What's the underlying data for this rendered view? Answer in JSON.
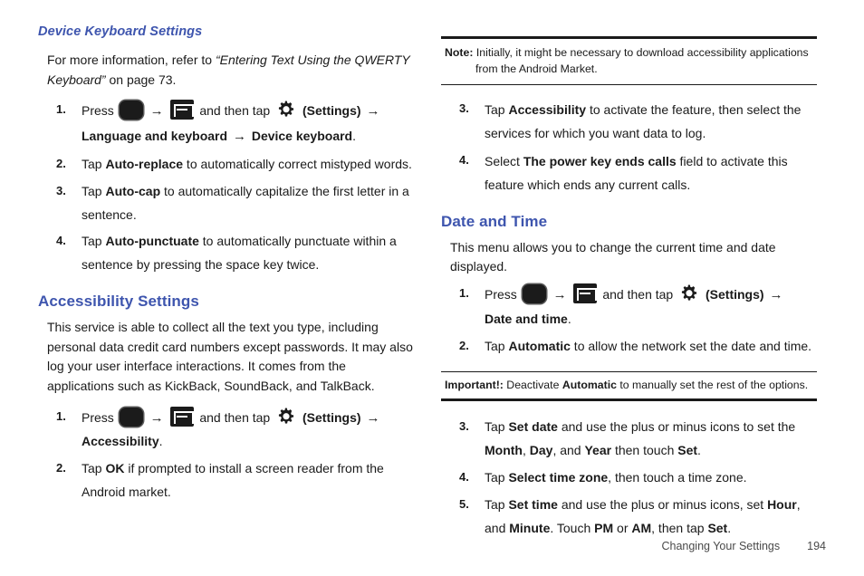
{
  "page": {
    "footer_section": "Changing Your Settings",
    "footer_page_number": "194",
    "heading_color": "#3e55ae",
    "text_color": "#1a1a1a"
  },
  "left_column": {
    "subsection_heading": "Device Keyboard Settings",
    "intro": {
      "lead": "For more information, refer to ",
      "ref_title": "“Entering Text Using the QWERTY Keyboard”",
      "tail": " on page 73."
    },
    "keyboard_steps": [
      {
        "num": "1.",
        "press_label": "Press",
        "and_then_tap": "and then tap",
        "settings_label": "(Settings)",
        "path_1": "Language and keyboard",
        "path_2": "Device keyboard",
        "period": "."
      },
      {
        "num": "2.",
        "lead": "Tap ",
        "bold": "Auto-replace",
        "tail": " to automatically correct mistyped words."
      },
      {
        "num": "3.",
        "lead": "Tap ",
        "bold": "Auto-cap",
        "tail": " to automatically capitalize the first letter in a sentence."
      },
      {
        "num": "4.",
        "lead": "Tap ",
        "bold": "Auto-punctuate",
        "tail": " to automatically punctuate within a sentence by pressing the space key twice."
      }
    ],
    "accessibility": {
      "heading": "Accessibility Settings",
      "paragraph": "This service is able to collect all the text you type, including personal data credit card numbers except passwords. It may also log your user interface interactions. It comes from the applications such as KickBack, SoundBack, and TalkBack.",
      "steps": [
        {
          "num": "1.",
          "press_label": "Press",
          "and_then_tap": "and then tap",
          "settings_label": "(Settings)",
          "path_1": "Accessibility",
          "period": "."
        },
        {
          "num": "2.",
          "lead": "Tap ",
          "bold": "OK",
          "tail": " if prompted to install a screen reader from the Android market."
        }
      ]
    }
  },
  "right_column": {
    "note": {
      "label": "Note:",
      "line1": " Initially, it might be necessary to download accessibility applications",
      "line2": "from the Android Market."
    },
    "accessibility_steps": [
      {
        "num": "3.",
        "lead": "Tap ",
        "bold": "Accessibility",
        "tail": " to activate the feature, then select the services for which you want data to log."
      },
      {
        "num": "4.",
        "lead": "Select ",
        "bold": "The power key ends calls",
        "tail": " field to activate this feature which ends any current calls."
      }
    ],
    "date_time": {
      "heading": "Date and Time",
      "paragraph": "This menu allows you to change the current time and date displayed.",
      "steps_before": [
        {
          "num": "1.",
          "press_label": "Press",
          "and_then_tap": "and then tap",
          "settings_label": "(Settings)",
          "path_1": "Date and time",
          "period": "."
        },
        {
          "num": "2.",
          "lead": "Tap ",
          "bold": "Automatic",
          "tail": " to allow the network set the date and time."
        }
      ],
      "important": {
        "label": "Important!:",
        "lead": " Deactivate ",
        "bold": "Automatic",
        "tail": " to manually set the rest of the options."
      },
      "steps_after": [
        {
          "num": "3.",
          "p1": "Tap ",
          "b1": "Set date",
          "p2": " and use the plus or minus icons to set the ",
          "b2": "Month",
          "p3": ", ",
          "b3": "Day",
          "p4": ", and ",
          "b4": "Year",
          "p5": " then touch ",
          "b5": "Set",
          "p6": "."
        },
        {
          "num": "4.",
          "p1": "Tap ",
          "b1": "Select time zone",
          "p2": ", then touch a time zone."
        },
        {
          "num": "5.",
          "p1": "Tap ",
          "b1": "Set time",
          "p2": " and use the plus or minus icons, set ",
          "b2": "Hour",
          "p3": ", and ",
          "b3": "Minute",
          "p4": ". Touch ",
          "b4": "PM",
          "p5": " or ",
          "b5": "AM",
          "p6": ", then tap ",
          "b6": "Set",
          "p7": "."
        }
      ]
    }
  },
  "icons": {
    "home": "home-key-icon",
    "menu": "menu-key-icon",
    "gear": "settings-gear-icon",
    "arrow": "→"
  }
}
